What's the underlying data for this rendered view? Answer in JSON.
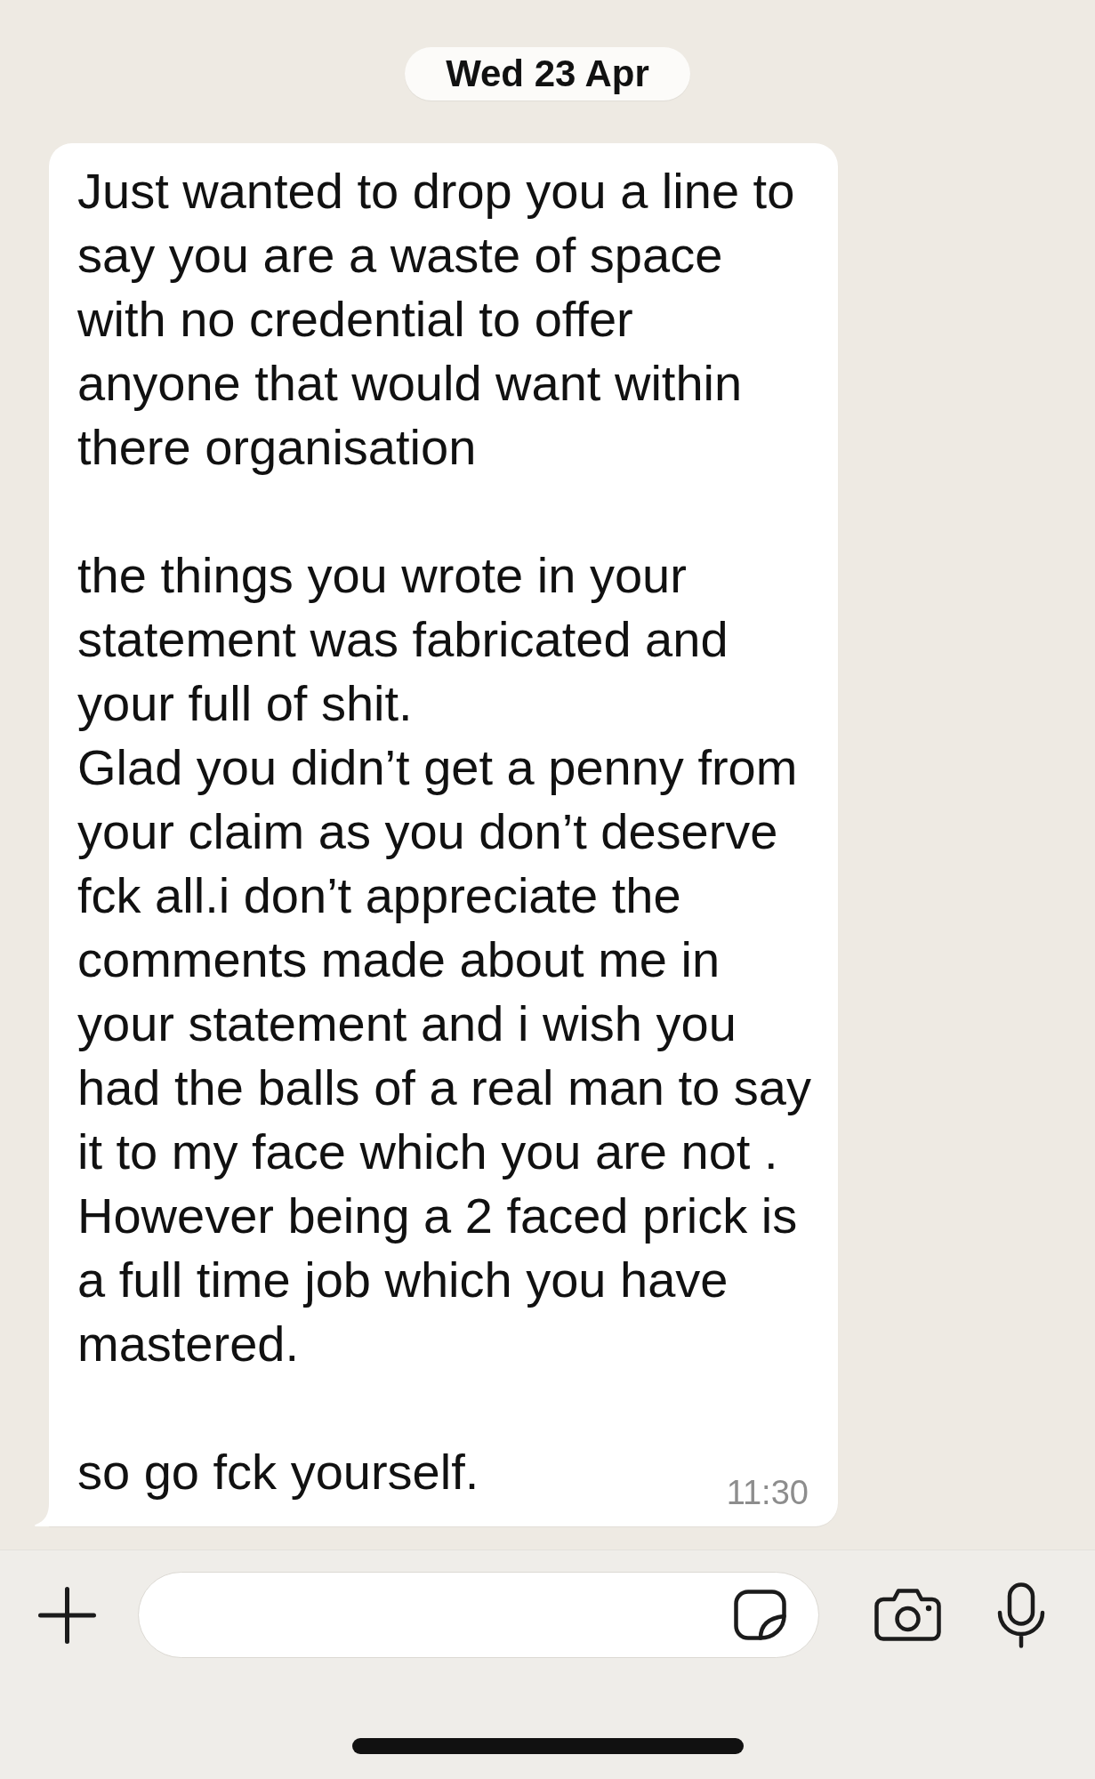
{
  "date_divider": {
    "label": "Wed 23 Apr"
  },
  "messages": [
    {
      "kind": "incoming",
      "tail": true,
      "paragraphs": [
        "Just wanted to drop you a line to\nsay you are a waste of space\nwith no credential to offer\nanyone that would want within\nthere organisation",
        "the things you wrote in your\nstatement was fabricated and\nyour full of shit.\nGlad you didn’t get a penny from\nyour claim as you don’t deserve\nfck all.i don’t appreciate the\ncomments made about me in\nyour statement and i wish you\nhad the balls of a real man to say\nit to my face which you are not .\nHowever being a 2 faced prick is\na full time job which you have\nmastered.",
        "so go fck yourself."
      ],
      "time": "11:30"
    }
  ]
}
